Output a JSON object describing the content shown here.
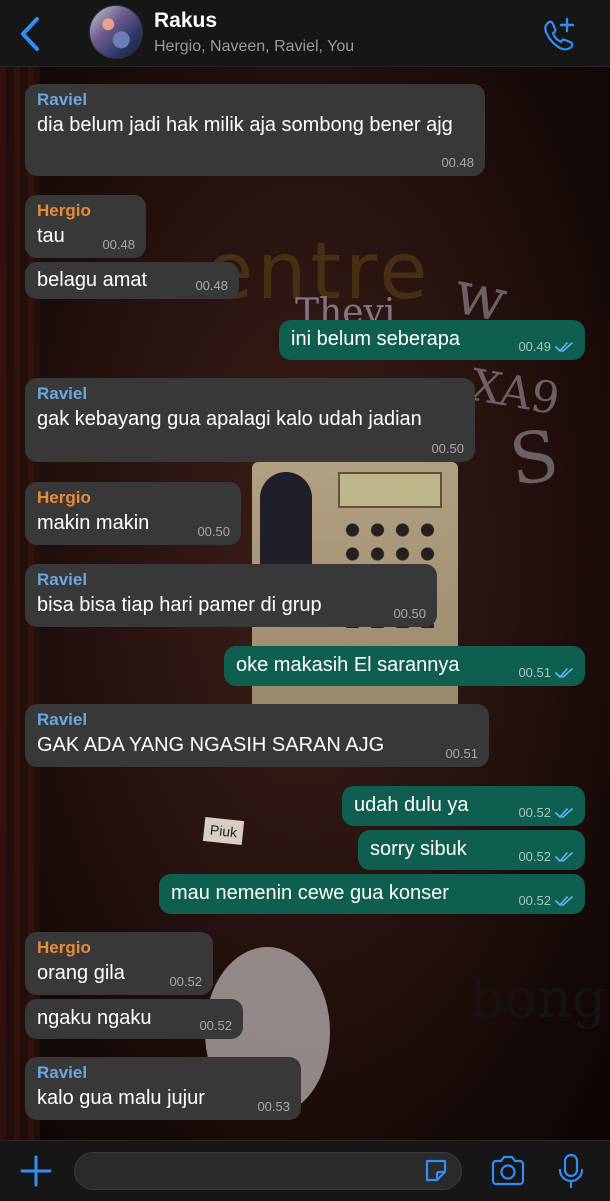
{
  "header": {
    "title": "Rakus",
    "subtitle": "Hergio, Naveen, Raviel, You"
  },
  "wallpaper": {
    "sign_text": "entre",
    "sticker_text": "Piuk"
  },
  "messages": [
    {
      "direction": "in",
      "sender": "Raviel",
      "text": "dia belum jadi hak milik aja sombong bener ajg",
      "time": "00.48"
    },
    {
      "direction": "in",
      "sender": "Hergio",
      "text": "tau",
      "time": "00.48"
    },
    {
      "direction": "in",
      "sender": "",
      "text": "belagu amat",
      "time": "00.48"
    },
    {
      "direction": "out",
      "sender": "",
      "text": "ini belum seberapa",
      "time": "00.49",
      "status": "read"
    },
    {
      "direction": "in",
      "sender": "Raviel",
      "text": "gak kebayang gua apalagi kalo udah jadian",
      "time": "00.50"
    },
    {
      "direction": "in",
      "sender": "Hergio",
      "text": "makin makin",
      "time": "00.50"
    },
    {
      "direction": "in",
      "sender": "Raviel",
      "text": "bisa bisa tiap hari pamer di grup",
      "time": "00.50"
    },
    {
      "direction": "out",
      "sender": "",
      "text": "oke makasih El sarannya",
      "time": "00.51",
      "status": "read"
    },
    {
      "direction": "in",
      "sender": "Raviel",
      "text": "GAK ADA YANG NGASIH SARAN AJG",
      "time": "00.51"
    },
    {
      "direction": "out",
      "sender": "",
      "text": "udah dulu ya",
      "time": "00.52",
      "status": "read"
    },
    {
      "direction": "out",
      "sender": "",
      "text": "sorry sibuk",
      "time": "00.52",
      "status": "read"
    },
    {
      "direction": "out",
      "sender": "",
      "text": "mau nemenin cewe gua konser",
      "time": "00.52",
      "status": "read"
    },
    {
      "direction": "in",
      "sender": "Hergio",
      "text": "orang gila",
      "time": "00.52"
    },
    {
      "direction": "in",
      "sender": "",
      "text": "ngaku ngaku",
      "time": "00.52"
    },
    {
      "direction": "in",
      "sender": "Raviel",
      "text": "kalo gua malu jujur",
      "time": "00.53"
    }
  ],
  "icons": {
    "back": "chevron-left-icon",
    "call": "phone-plus-icon",
    "attach": "plus-icon",
    "sticker": "sticker-icon",
    "camera": "camera-icon",
    "mic": "microphone-icon"
  },
  "colors": {
    "accent": "#2f8ff6",
    "incoming_bubble": "#383838",
    "outgoing_bubble": "#0e5f4f",
    "raviel_name": "#6aa9df",
    "hergio_name": "#e98c3a",
    "read_ticks": "#5fb4f3"
  },
  "input": {
    "value": "",
    "placeholder": ""
  }
}
